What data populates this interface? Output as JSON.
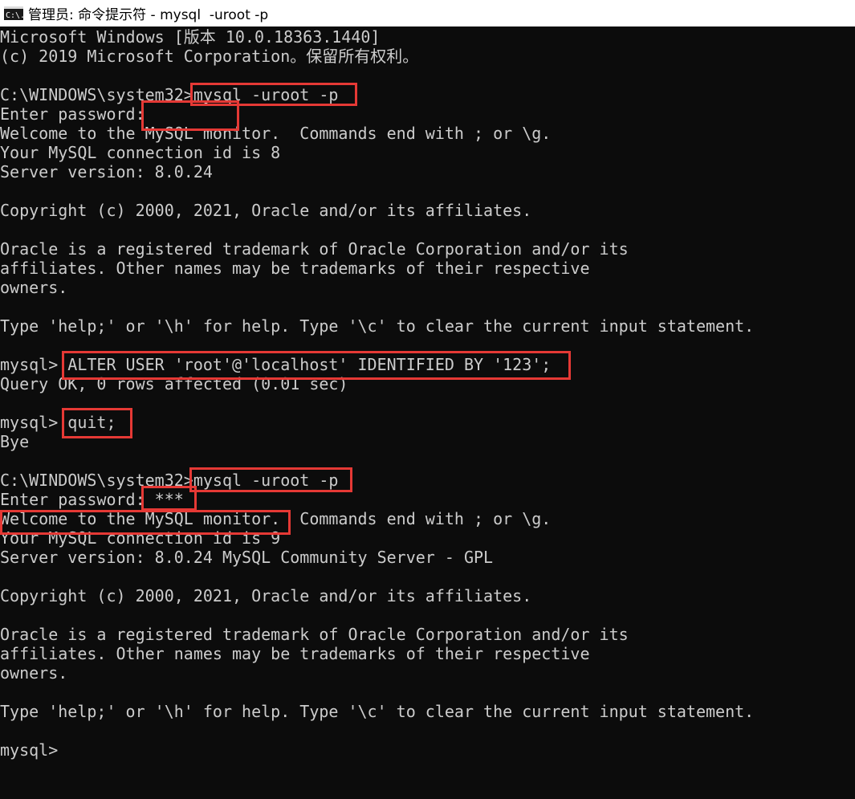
{
  "window": {
    "title": "管理员: 命令提示符 - mysql  -uroot -p",
    "icon": "cmd-icon",
    "icon_text": "C:\\."
  },
  "colors": {
    "background": "#0c0c0c",
    "text": "#cccccc",
    "highlight": "#e53935",
    "titlebar": "#ffffff"
  },
  "console": {
    "lines": [
      "Microsoft Windows [版本 10.0.18363.1440]",
      "(c) 2019 Microsoft Corporation。保留所有权利。",
      "",
      "C:\\WINDOWS\\system32>mysql -uroot -p",
      "Enter password:",
      "Welcome to the MySQL monitor.  Commands end with ; or \\g.",
      "Your MySQL connection id is 8",
      "Server version: 8.0.24",
      "",
      "Copyright (c) 2000, 2021, Oracle and/or its affiliates.",
      "",
      "Oracle is a registered trademark of Oracle Corporation and/or its",
      "affiliates. Other names may be trademarks of their respective",
      "owners.",
      "",
      "Type 'help;' or '\\h' for help. Type '\\c' to clear the current input statement.",
      "",
      "mysql> ALTER USER 'root'@'localhost' IDENTIFIED BY '123';",
      "Query OK, 0 rows affected (0.01 sec)",
      "",
      "mysql> quit;",
      "Bye",
      "",
      "C:\\WINDOWS\\system32>mysql -uroot -p",
      "Enter password: ***",
      "Welcome to the MySQL monitor.  Commands end with ; or \\g.",
      "Your MySQL connection id is 9",
      "Server version: 8.0.24 MySQL Community Server - GPL",
      "",
      "Copyright (c) 2000, 2021, Oracle and/or its affiliates.",
      "",
      "Oracle is a registered trademark of Oracle Corporation and/or its",
      "affiliates. Other names may be trademarks of their respective",
      "owners.",
      "",
      "Type 'help;' or '\\h' for help. Type '\\c' to clear the current input statement.",
      "",
      "mysql>"
    ]
  }
}
